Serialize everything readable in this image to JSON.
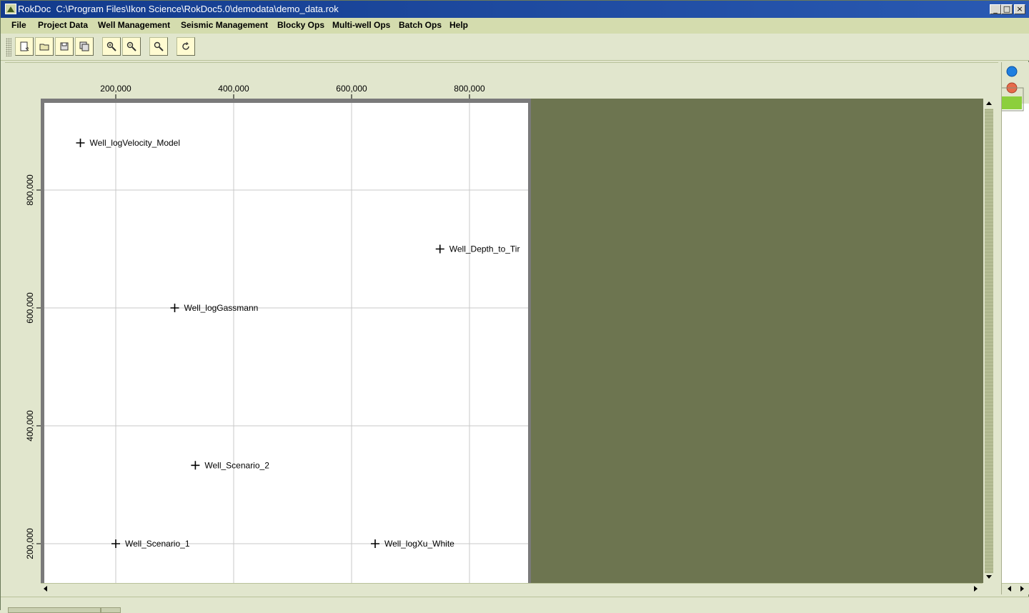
{
  "window": {
    "app_name": "RokDoc",
    "file_path": "C:\\Program Files\\Ikon Science\\RokDoc5.0\\demodata\\demo_data.rok",
    "title": "RokDoc  C:\\Program Files\\Ikon Science\\RokDoc5.0\\demodata\\demo_data.rok",
    "controls": {
      "minimize": "_",
      "maximize": "□",
      "close": "×"
    }
  },
  "menu": [
    {
      "label": "File"
    },
    {
      "label": "Project Data"
    },
    {
      "label": "Well Management"
    },
    {
      "label": "Seismic Management"
    },
    {
      "label": "Blocky Ops"
    },
    {
      "label": "Multi-well Ops"
    },
    {
      "label": "Batch Ops"
    },
    {
      "label": "Help"
    }
  ],
  "toolbar": [
    {
      "icon": "new-document-icon"
    },
    {
      "icon": "open-folder-icon"
    },
    {
      "icon": "save-icon"
    },
    {
      "icon": "save-as-icon"
    },
    {
      "icon": "zoom-in-icon"
    },
    {
      "icon": "zoom-out-icon"
    },
    {
      "icon": "zoom-icon"
    },
    {
      "icon": "rotate-icon"
    }
  ],
  "map": {
    "x_ticks": [
      "200,000",
      "400,000",
      "600,000",
      "800,000"
    ],
    "y_ticks": [
      "800,000",
      "600,000",
      "400,000",
      "200,000"
    ],
    "x_tick_values": [
      200000,
      400000,
      600000,
      800000
    ],
    "y_tick_values": [
      800000,
      600000,
      400000,
      200000
    ],
    "wells": [
      {
        "name": "Well_logVelocity_Model",
        "x": 140000,
        "y": 880000
      },
      {
        "name": "Well_Depth_to_Tir",
        "x": 750000,
        "y": 700000
      },
      {
        "name": "Well_logGassmann",
        "x": 300000,
        "y": 600000
      },
      {
        "name": "Well_Scenario_2",
        "x": 335000,
        "y": 333000
      },
      {
        "name": "Well_Scenario_1",
        "x": 200000,
        "y": 200000
      },
      {
        "name": "Well_logXu_White",
        "x": 640000,
        "y": 200000
      }
    ],
    "colors": {
      "plot_background": "#ffffff",
      "outside_area": "#6d7550",
      "grid": "#c8c8c8",
      "frame": "#7a7a7a"
    }
  },
  "right_panel": {
    "layer_icons": [
      "blue-circle-icon",
      "red-circle-icon"
    ],
    "swatch_color": "#8ccf3c"
  }
}
